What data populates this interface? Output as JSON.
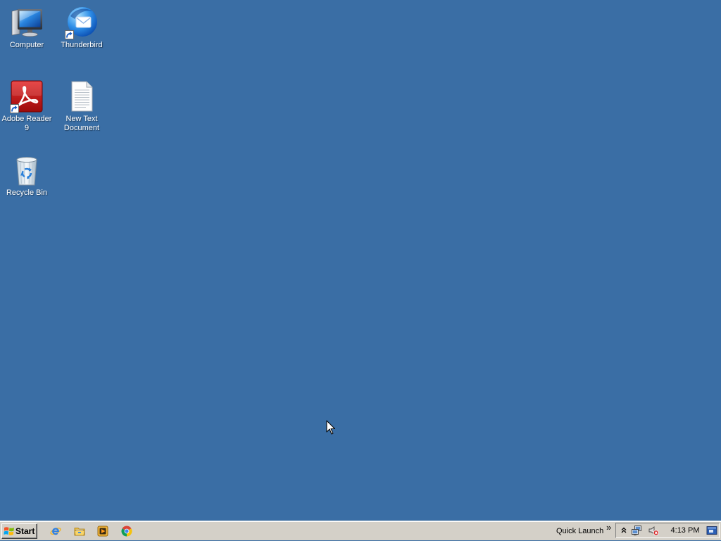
{
  "desktop": {
    "background_color": "#3A6EA5",
    "icons": [
      {
        "label": "Computer",
        "icon": "computer-icon",
        "shortcut": false
      },
      {
        "label": "Thunderbird",
        "icon": "thunderbird-icon",
        "shortcut": true
      },
      {
        "label": "Adobe Reader 9",
        "icon": "adobe-reader-icon",
        "shortcut": true
      },
      {
        "label": "New Text Document",
        "icon": "text-document-icon",
        "shortcut": false
      },
      {
        "label": "Recycle Bin",
        "icon": "recycle-bin-icon",
        "shortcut": false
      }
    ]
  },
  "taskbar": {
    "background_color": "#D4D0C8",
    "start_button": {
      "label": "Start",
      "icon": "windows-logo-icon"
    },
    "quick_launch_icons": [
      {
        "icon": "internet-explorer-icon"
      },
      {
        "icon": "windows-explorer-icon"
      },
      {
        "icon": "windows-media-player-icon"
      },
      {
        "icon": "google-chrome-icon"
      }
    ],
    "toolbar": {
      "label": "Quick Launch",
      "overflow": "»"
    },
    "tray": {
      "icons": [
        "show-hidden-icons-icon",
        "network-icon",
        "volume-muted-icon",
        "show-desktop-icon"
      ],
      "clock": "4:13 PM"
    }
  }
}
